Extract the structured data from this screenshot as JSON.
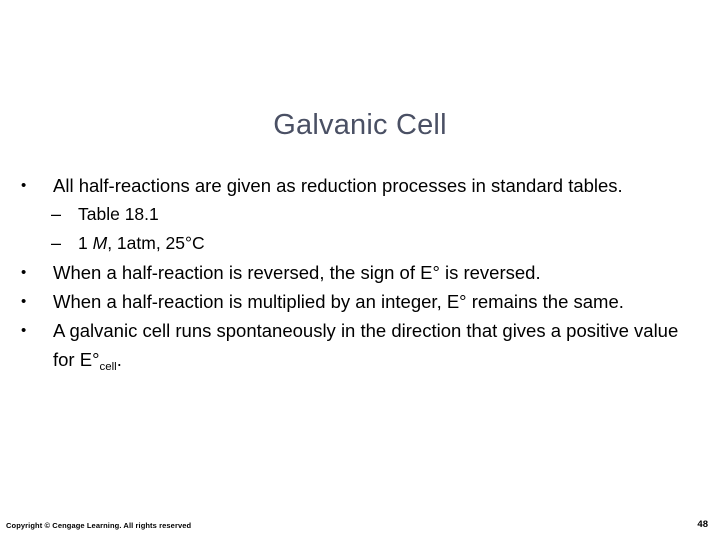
{
  "slide": {
    "title": "Galvanic Cell",
    "title_color": "#4a5064",
    "background_color": "#ffffff",
    "body_color": "#000000",
    "bullets": [
      {
        "level": 1,
        "marker": "•",
        "text": "All half-reactions are given as reduction processes in standard tables."
      },
      {
        "level": 2,
        "marker": "–",
        "text": "Table 18.1"
      },
      {
        "level": 2,
        "marker": "–",
        "text_pre": "1 ",
        "text_italic": "M",
        "text_post": ", 1atm, 25°C"
      },
      {
        "level": 1,
        "marker": "•",
        "text": "When a half-reaction is reversed, the sign of E° is reversed."
      },
      {
        "level": 1,
        "marker": "•",
        "text": "When a half-reaction is multiplied by an integer, E° remains the same."
      },
      {
        "level": 1,
        "marker": "•",
        "text_pre": "A galvanic cell runs spontaneously in the direction that gives a positive value for E°",
        "text_sub": "cell",
        "text_post": "."
      }
    ]
  },
  "footer": {
    "copyright": "Copyright © Cengage Learning. All rights reserved",
    "page_number": "48"
  }
}
